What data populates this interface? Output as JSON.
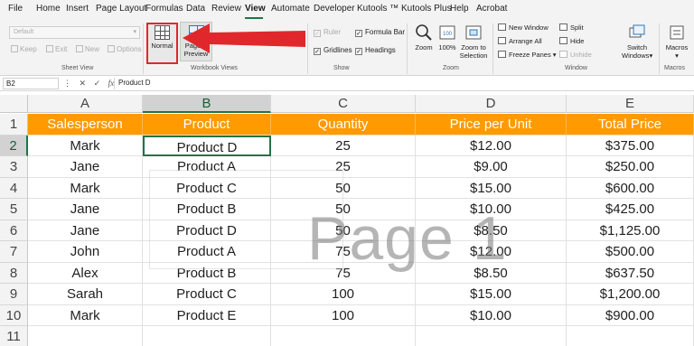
{
  "menu": {
    "items": [
      "File",
      "Home",
      "Insert",
      "Page Layout",
      "Formulas",
      "Data",
      "Review",
      "View",
      "Automate",
      "Developer",
      "Kutools ™",
      "Kutools Plus",
      "Help",
      "Acrobat"
    ],
    "active": "View"
  },
  "ribbon": {
    "sheet_view": {
      "dropdown_value": "Default",
      "keep": "Keep",
      "exit": "Exit",
      "new": "New",
      "options": "Options",
      "label": "Sheet View"
    },
    "workbook_views": {
      "normal": "Normal",
      "page_break_line1": "Page B",
      "page_break_line2": "Preview",
      "page_layout_fragment": "out",
      "label": "Workbook Views"
    },
    "show": {
      "ruler": "Ruler",
      "formula_bar": "Formula Bar",
      "gridlines": "Gridlines",
      "headings": "Headings",
      "label": "Show"
    },
    "zoom": {
      "zoom": "Zoom",
      "hundred": "100%",
      "zoom_to_line1": "Zoom to",
      "zoom_to_line2": "Selection",
      "label": "Zoom"
    },
    "window": {
      "new_window": "New Window",
      "arrange_all": "Arrange All",
      "freeze_panes": "Freeze Panes",
      "split": "Split",
      "hide": "Hide",
      "unhide": "Unhide",
      "switch_line1": "Switch",
      "switch_line2": "Windows",
      "label": "Window"
    },
    "macros": {
      "macros": "Macros",
      "label": "Macros"
    }
  },
  "formula_bar": {
    "name_box": "B2",
    "fx": "fx",
    "content": "Product D"
  },
  "sheet": {
    "columns": [
      "A",
      "B",
      "C",
      "D",
      "E"
    ],
    "rows": [
      "1",
      "2",
      "3",
      "4",
      "5",
      "6",
      "7",
      "8",
      "9",
      "10",
      "11"
    ],
    "header": [
      "Salesperson",
      "Product",
      "Quantity",
      "Price per Unit",
      "Total Price"
    ],
    "data": [
      [
        "Mark",
        "Product D",
        "25",
        "$12.00",
        "$375.00"
      ],
      [
        "Jane",
        "Product A",
        "25",
        "$9.00",
        "$250.00"
      ],
      [
        "Mark",
        "Product C",
        "50",
        "$15.00",
        "$600.00"
      ],
      [
        "Jane",
        "Product B",
        "50",
        "$10.00",
        "$425.00"
      ],
      [
        "Jane",
        "Product D",
        "50",
        "$8.50",
        "$1,125.00"
      ],
      [
        "John",
        "Product A",
        "75",
        "$12.00",
        "$500.00"
      ],
      [
        "Alex",
        "Product B",
        "75",
        "$8.50",
        "$637.50"
      ],
      [
        "Sarah",
        "Product C",
        "100",
        "$15.00",
        "$1,200.00"
      ],
      [
        "Mark",
        "Product E",
        "100",
        "$10.00",
        "$900.00"
      ]
    ],
    "selected_cell": "B2",
    "header_color": "#ff9a00"
  },
  "watermark": "Page 1",
  "annotation": {
    "arrow_color": "#e0282c",
    "highlight_color": "#e0282c"
  }
}
